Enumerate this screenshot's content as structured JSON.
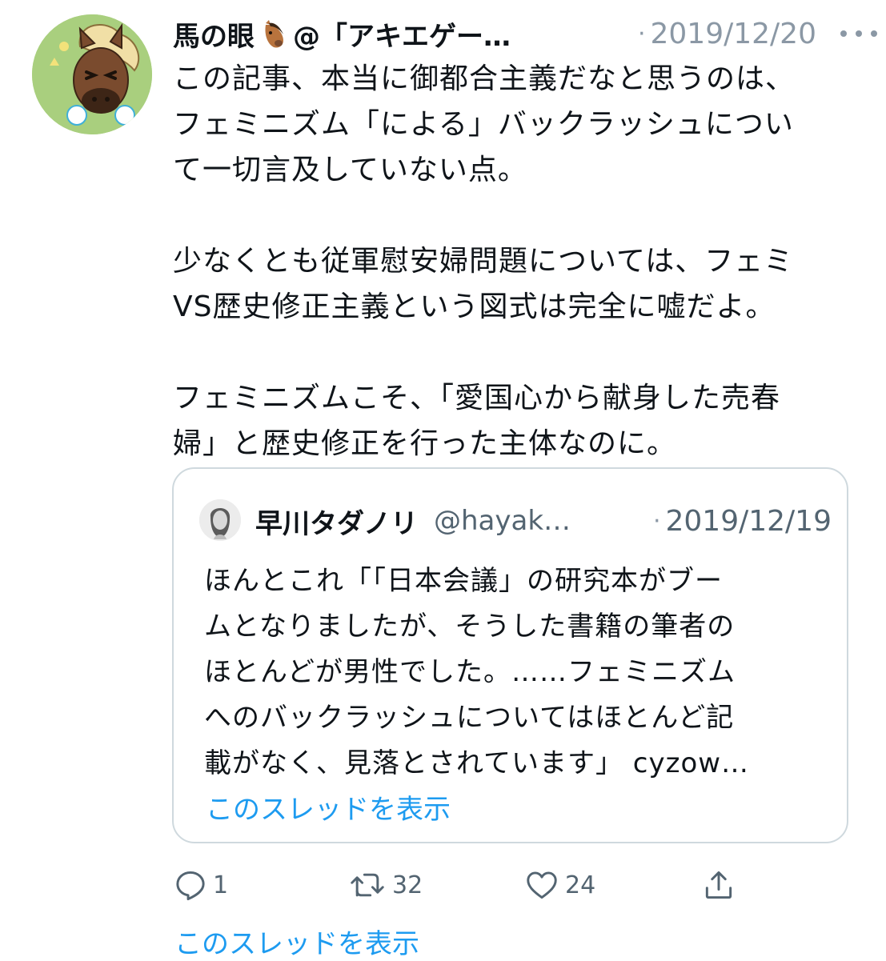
{
  "tweet": {
    "display_name": "馬の眼",
    "name_emoji": "horse-face-emoji",
    "handle": "@「アキエゲー…",
    "date_separator": "·",
    "date": "2019/12/20",
    "more_icon": "more-dots-icon",
    "paragraphs": [
      "この記事、本当に御都合主義だなと思うのは、\nフェミニズム「による」バックラッシュについ\nて一切言及していない点。",
      "少なくとも従軍慰安婦問題については、フェミ\nVS歴史修正主義という図式は完全に嘘だよ。",
      "フェミニズムこそ、「愛国心から献身した売春\n婦」と歴史修正を行った主体なのに。"
    ]
  },
  "quoted_tweet": {
    "display_name": "早川タダノリ",
    "handle": "@hayak…",
    "date_separator": "·",
    "date": "2019/12/19",
    "text": "ほんとこれ「「日本会議」の研究本がブー\nムとなりましたが、そうした書籍の筆者の\nほとんどが男性でした。……フェミニズム\nへのバックラッシュについてはほとんど記\n載がなく、見落とされています」 cyzow…",
    "thread_link": "このスレッドを表示"
  },
  "actions": {
    "reply": {
      "icon": "reply-icon",
      "count": "1"
    },
    "retweet": {
      "icon": "retweet-icon",
      "count": "32"
    },
    "like": {
      "icon": "heart-icon",
      "count": "24"
    },
    "share": {
      "icon": "share-icon"
    }
  },
  "thread_link": "このスレッドを表示",
  "colors": {
    "text": "#0f1419",
    "muted": "#8b98a5",
    "secondary": "#536471",
    "link": "#1d9bf0",
    "border": "#cfd9de"
  }
}
